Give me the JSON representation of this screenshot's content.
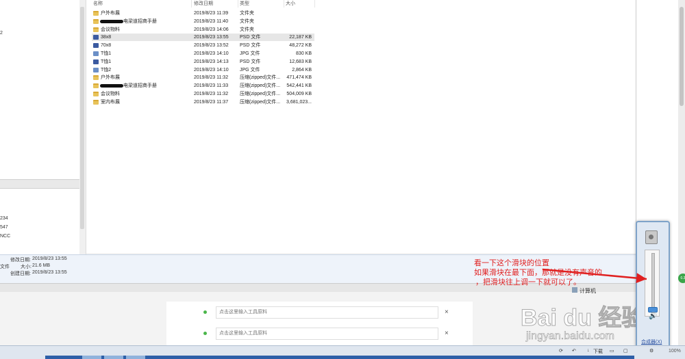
{
  "left_pane": {
    "items_top": [
      "234",
      "547",
      "NCC"
    ]
  },
  "columns": {
    "name": "名称",
    "date": "修改日期",
    "type": "类型",
    "size": "大小"
  },
  "files": [
    {
      "name": "户外布展",
      "date": "2019/8/23 11:39",
      "type": "文件夹",
      "size": "",
      "icon": "folder-icon"
    },
    {
      "name": "电梁道招商手册",
      "date": "2019/8/23 11:40",
      "type": "文件夹",
      "size": "",
      "icon": "folder-icon",
      "redacted": true
    },
    {
      "name": "会议物料",
      "date": "2019/8/23 14:06",
      "type": "文件夹",
      "size": "",
      "icon": "folder-icon"
    },
    {
      "name": "38x8",
      "date": "2019/8/23 13:55",
      "type": "PSD 文件",
      "size": "22,187 KB",
      "icon": "psd-file-icon",
      "selected": true
    },
    {
      "name": "70x8",
      "date": "2019/8/23 13:52",
      "type": "PSD 文件",
      "size": "48,272 KB",
      "icon": "psd-file-icon"
    },
    {
      "name": "T恤1",
      "date": "2019/8/23 14:10",
      "type": "JPG 文件",
      "size": "830 KB",
      "icon": "jpg-file-icon"
    },
    {
      "name": "T恤1",
      "date": "2019/8/23 14:13",
      "type": "PSD 文件",
      "size": "12,683 KB",
      "icon": "psd-file-icon"
    },
    {
      "name": "T恤2",
      "date": "2019/8/23 14:10",
      "type": "JPG 文件",
      "size": "2,864 KB",
      "icon": "jpg-file-icon"
    },
    {
      "name": "户外布展",
      "date": "2019/8/23 11:32",
      "type": "压缩(zipped)文件...",
      "size": "471,474 KB",
      "icon": "folder-zip-icon"
    },
    {
      "name": "电梁道招商手册",
      "date": "2019/8/23 11:33",
      "type": "压缩(zipped)文件...",
      "size": "542,441 KB",
      "icon": "folder-zip-icon",
      "redacted": true
    },
    {
      "name": "会议物料",
      "date": "2019/8/23 11:32",
      "type": "压缩(zipped)文件...",
      "size": "504,009 KB",
      "icon": "folder-zip-icon"
    },
    {
      "name": "室内布展",
      "date": "2019/8/23 11:37",
      "type": "压缩(zipped)文件...",
      "size": "3,681,023...",
      "icon": "folder-zip-icon"
    }
  ],
  "details": {
    "modified_label": "修改日期:",
    "modified_value": "2019/8/23 13:55",
    "type_label": "文件",
    "size_label": "大小:",
    "size_value": "21.6 MB",
    "created_label": "创建日期:",
    "created_value": "2019/8/23 13:55"
  },
  "webpage": {
    "input1_placeholder": "点击这里输入工具原料",
    "input2_placeholder": "点击这里输入工具原料",
    "close_symbol": "×"
  },
  "computer_label": "计算机",
  "mixer": {
    "label": "合成器(X)",
    "volume_level_fraction": 0.04,
    "speaker_symbol": "🔊"
  },
  "annotation": {
    "line1": "看一下这个滑块的位置",
    "line2": "如果滑块在最下面，那就是没有声音的",
    "line3": "，把滑块往上调一下就可以了。",
    "color": "#e02020"
  },
  "watermark": {
    "brand": "Bai du 经验",
    "url": "jingyan.baidu.com"
  },
  "taskbar": {
    "download_label": "下载",
    "zoom": "100%"
  },
  "badge": "0.3"
}
